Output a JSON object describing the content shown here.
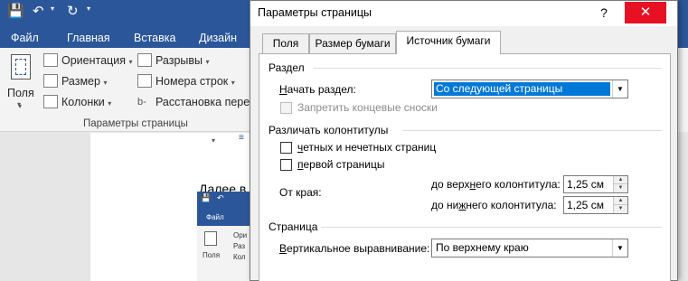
{
  "word": {
    "tabs": [
      "Файл",
      "Главная",
      "Вставка",
      "Дизайн"
    ],
    "ribbon": {
      "field_label": "Поля",
      "orientation": "Ориентация",
      "size": "Размер",
      "columns": "Колонки",
      "breaks": "Разрывы",
      "line_numbers": "Номера строк",
      "hyphenation": "Расстановка перен",
      "group_label": "Параметры страницы"
    },
    "doc_text": "Далее в",
    "nested": {
      "tab": "Файл",
      "button": "Поля",
      "item_1": "Ори",
      "item_2": "Раз",
      "item_3": "Кол"
    }
  },
  "dialog": {
    "title": "Параметры страницы",
    "help": "?",
    "close": "✕",
    "tabs": [
      {
        "label": "Поля"
      },
      {
        "label": "Размер бумаги"
      },
      {
        "label": "Источник бумаги"
      }
    ],
    "section": {
      "title": "Раздел",
      "start_label": "Начать раздел:",
      "start_value": "Со следующей страницы",
      "suppress_endnotes": "Запретить концевые сноски"
    },
    "headers": {
      "title": "Различать колонтитулы",
      "odd_even": "четных и нечетных страниц",
      "first_page": "первой страницы",
      "from_edge": "От края:",
      "header_label": "до верхнего колонтитула:",
      "header_value": "1,25 см",
      "footer_label": "до нижнего колонтитула:",
      "footer_value": "1,25 см"
    },
    "page": {
      "title": "Страница",
      "valign_label": "Вертикальное выравнивание:",
      "valign_value": "По верхнему краю"
    }
  },
  "colors": {
    "word_blue": "#2b579a",
    "close_red": "#e81123",
    "selection": "#0078d7"
  }
}
